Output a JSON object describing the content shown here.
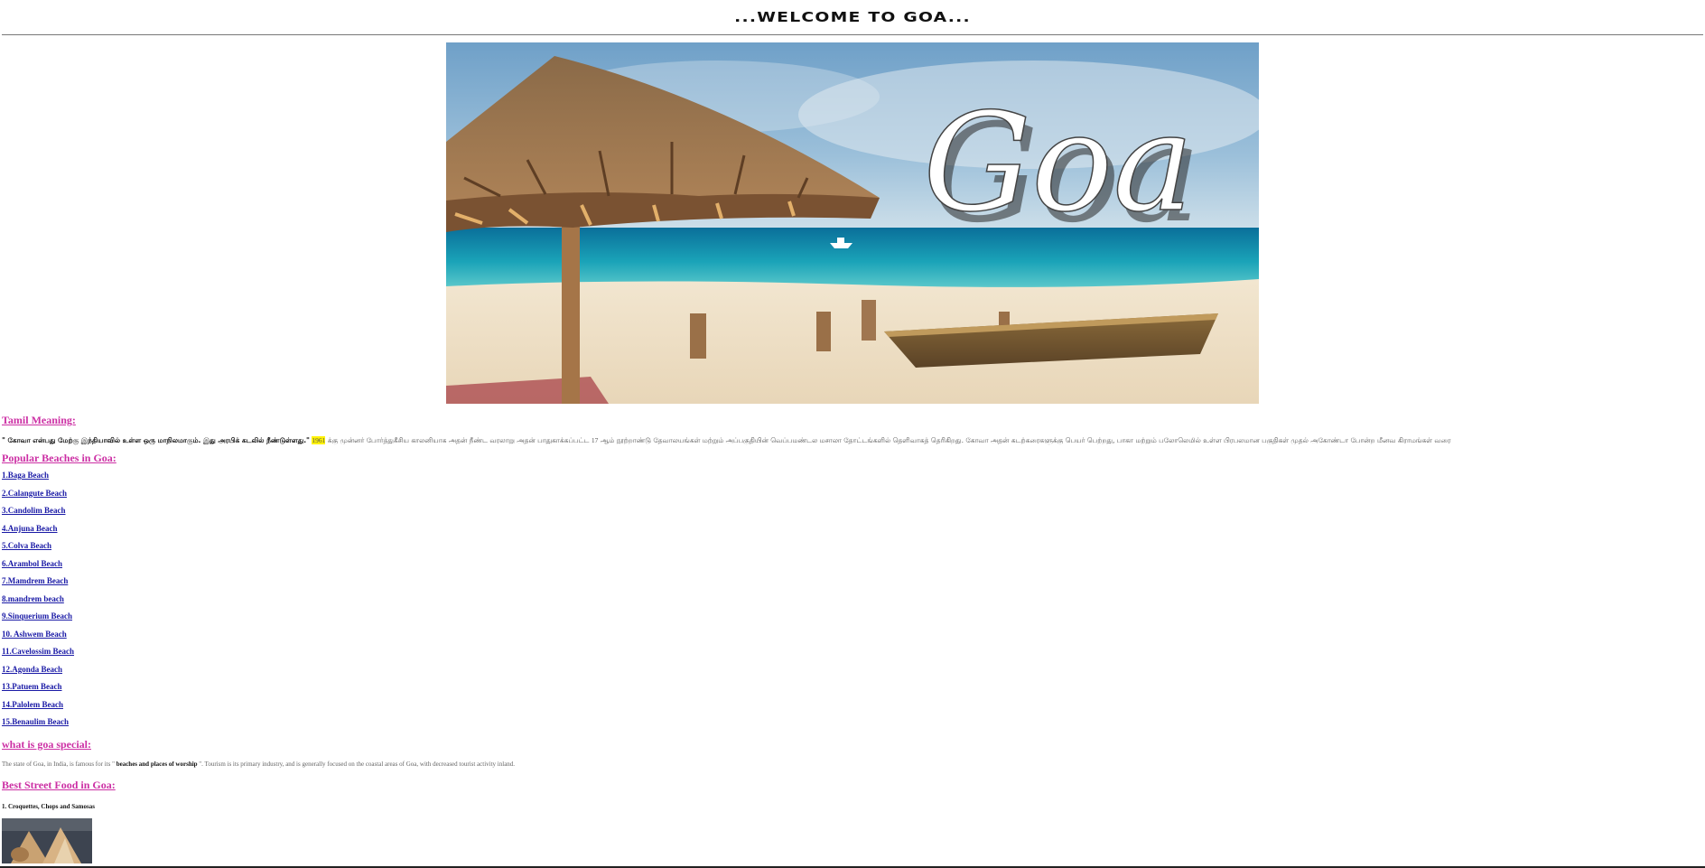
{
  "header": {
    "title": "...WELCOME TO GOA..."
  },
  "hero": {
    "overlay_text": "Goa"
  },
  "sections": {
    "tamil_heading": "Tamil Meaning:",
    "tamil_quote": "\" கோவா என்பது மேற்கு இந்தியாவில் உள்ள ஒரு மாநிலமாகும். இது அரபிக் கடலில் நீண்டுள்ளது.\"",
    "tamil_year": "1961",
    "tamil_text_1": "க்கு முன்னர் போர்த்துகீசிய காலனியாக அதன் நீண்ட வரலாறு அதன் பாதுகாக்கப்பட்ட",
    "tamil_century": "17",
    "tamil_text_2": "ஆம் நூற்றாண்டு தேவாலயங்கள் மற்றும் அப்பகுதியின் வெப்பமண்டல மசாலா தோட்டங்களில் தெளிவாகத் தெரிகிறது. கோவா அதன் கடற்கரைகளுக்கு பெயர் பெற்றது, பாகா மற்றும் பலோலெமில் உள்ள பிரபலமான பகுதிகள் முதல் அகோண்டா போன்ற மீனவ கிராமங்கள் வரை",
    "beaches_heading": "Popular Beaches in Goa:",
    "beaches": [
      "1.Baga Beach",
      "2.Calangute Beach",
      "3.Candolim Beach",
      "4.Anjuna Beach",
      "5.Colva Beach",
      "6.Arambol Beach",
      "7.Mamdrem Beach",
      "8.mandrem beach",
      "9.Sinquerium Beach",
      "10. Ashwem Beach",
      "11.Cavelossim Beach",
      "12.Agonda Beach",
      "13.Patuem Beach",
      "14.Palolem Beach",
      "15.Benaulim Beach"
    ],
    "special_heading": "what is goa special:",
    "special_text_1": "The state of Goa, in India, is famous for its \"",
    "special_emphasis": "beaches and places of worship",
    "special_text_2": "\". Tourism is its primary industry, and is generally focused on the coastal areas of Goa, with decreased tourist activity inland.",
    "food_heading": "Best Street Food in Goa:",
    "food_items": [
      "1. Croquettes, Chops and Samosas"
    ]
  },
  "colors": {
    "heading": "#cc2fa4",
    "link": "#1a1aa6",
    "highlight": "#fff200"
  }
}
